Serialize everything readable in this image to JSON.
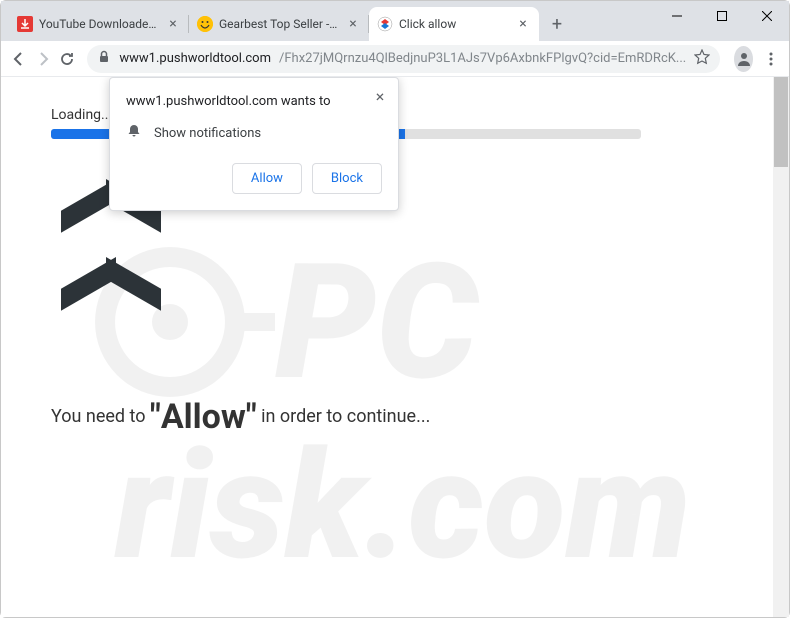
{
  "tabs": [
    {
      "title": "YouTube Downloader - Do",
      "favicon": "red"
    },
    {
      "title": "Gearbest Top Seller - Dive",
      "favicon": "yellow"
    },
    {
      "title": "Click allow",
      "favicon": "pcrisk",
      "active": true
    }
  ],
  "url": {
    "domain": "www1.pushworldtool.com",
    "path": "/Fhx27jMQrnzu4QlBedjnuP3L1AJs7Vp6AxbnkFPlgvQ?cid=EmRDRcK..."
  },
  "notification": {
    "title": "www1.pushworldtool.com wants to",
    "permission": "Show notifications",
    "allow": "Allow",
    "block": "Block"
  },
  "page": {
    "loading": "Loading...",
    "message_prefix": "You need to ",
    "message_allow": "Allow",
    "message_suffix": " in order to continue..."
  },
  "watermark": {
    "text1": "PC",
    "text2": "risk.com"
  }
}
